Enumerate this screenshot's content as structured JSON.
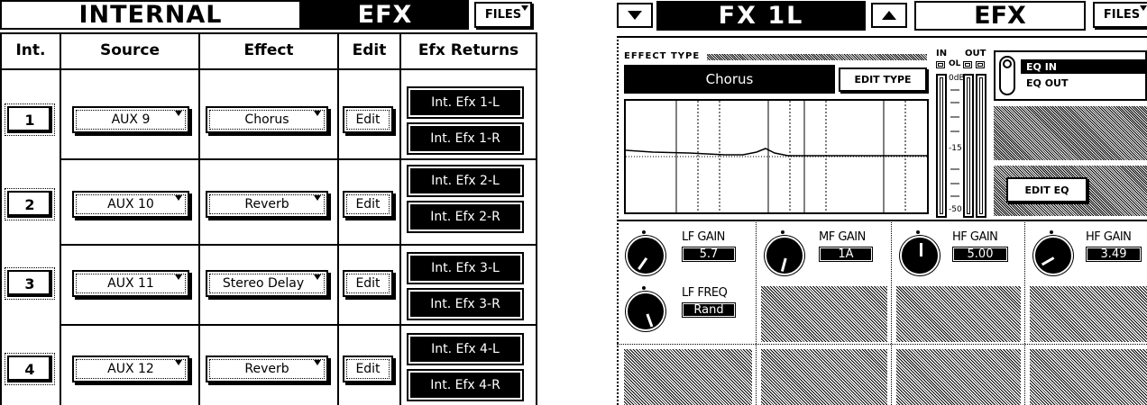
{
  "left": {
    "header": {
      "internal": "INTERNAL",
      "efx": "EFX",
      "files": "FILES"
    },
    "columns": [
      "Int.",
      "Source",
      "Effect",
      "Edit",
      "Efx Returns"
    ],
    "rows": [
      {
        "num": "1",
        "source": "AUX 9",
        "effect": "Chorus",
        "edit": "Edit",
        "ret_l": "Int. Efx 1-L",
        "ret_r": "Int. Efx 1-R"
      },
      {
        "num": "2",
        "source": "AUX 10",
        "effect": "Reverb",
        "edit": "Edit",
        "ret_l": "Int. Efx 2-L",
        "ret_r": "Int. Efx 2-R"
      },
      {
        "num": "3",
        "source": "AUX 11",
        "effect": "Stereo Delay",
        "edit": "Edit",
        "ret_l": "Int. Efx 3-L",
        "ret_r": "Int. Efx 3-R"
      },
      {
        "num": "4",
        "source": "AUX 12",
        "effect": "Reverb",
        "edit": "Edit",
        "ret_l": "Int. Efx 4-L",
        "ret_r": "Int. Efx 4-R"
      }
    ]
  },
  "right": {
    "header": {
      "fx_name": "FX 1L",
      "efx": "EFX",
      "files": "FILES"
    },
    "effect_type_label": "EFFECT TYPE",
    "effect_type_value": "Chorus",
    "edit_type": "EDIT TYPE",
    "meter": {
      "in": "IN",
      "out": "OUT",
      "ol": "OL",
      "odb": "0dB",
      "m15": "-15",
      "m50": "-50"
    },
    "eq": {
      "in": "EQ IN",
      "out": "EQ OUT",
      "edit": "EDIT EQ"
    },
    "knobs": {
      "lf_gain": {
        "label": "LF GAIN",
        "value": "5.7"
      },
      "mf_gain": {
        "label": "MF GAIN",
        "value": "1A"
      },
      "hf_gain1": {
        "label": "HF GAIN",
        "value": "5.00"
      },
      "hf_gain2": {
        "label": "HF GAIN",
        "value": "3.49"
      },
      "lf_freq": {
        "label": "LF FREQ",
        "value": "Rand"
      }
    },
    "icons": {
      "left_arrow": "triangle-down-icon",
      "up_arrow": "triangle-up-icon"
    }
  }
}
